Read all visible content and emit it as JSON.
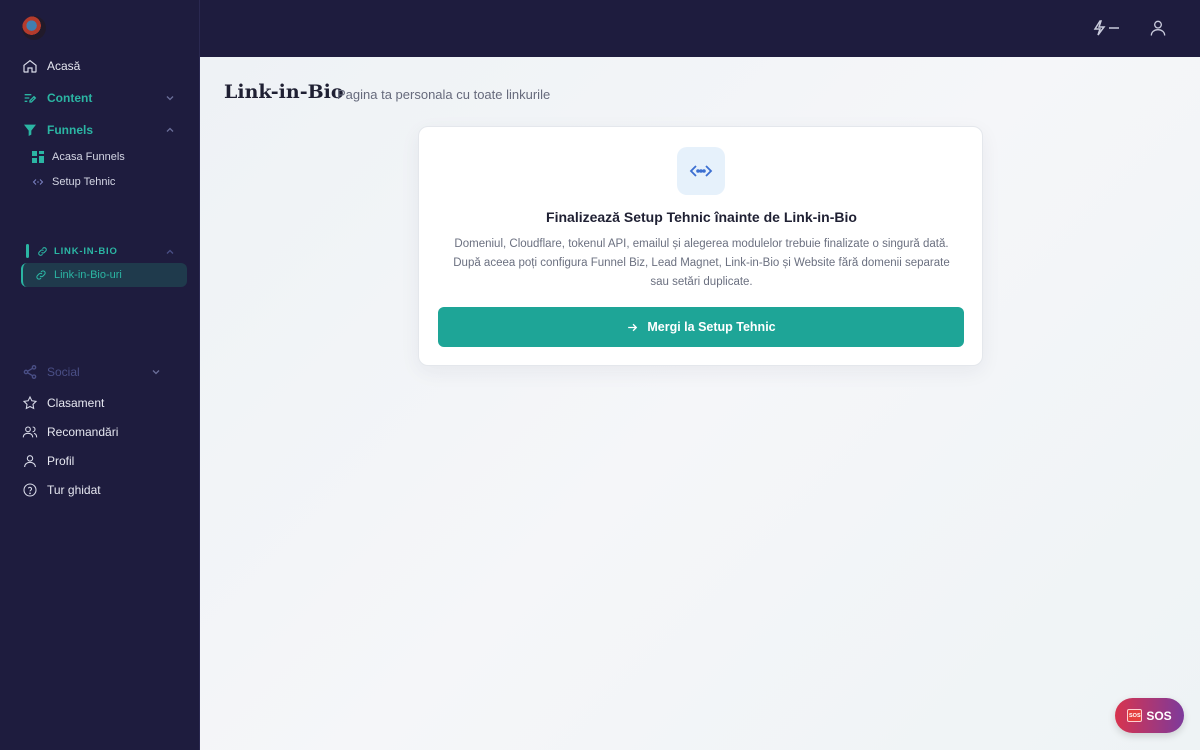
{
  "sidebar": {
    "items": [
      {
        "label": "Acasă",
        "icon": "home-icon"
      },
      {
        "label": "Content",
        "icon": "edit-icon"
      },
      {
        "label": "Funnels",
        "icon": "filter-icon"
      }
    ],
    "funnels_sub": [
      {
        "label": "Acasa Funnels",
        "icon": "dashboard-icon"
      },
      {
        "label": "Setup Tehnic",
        "icon": "code-icon"
      }
    ],
    "section": {
      "label": "LINK-IN-BIO",
      "icon": "link-icon"
    },
    "active_item": {
      "label": "Link-in-Bio-uri",
      "icon": "link-icon"
    },
    "social": {
      "label": "Social",
      "icon": "share-icon"
    },
    "bottom": [
      {
        "label": "Clasament",
        "icon": "star-icon"
      },
      {
        "label": "Recomandări",
        "icon": "users-icon"
      },
      {
        "label": "Profil",
        "icon": "user-icon"
      },
      {
        "label": "Tur ghidat",
        "icon": "help-icon"
      }
    ]
  },
  "topbar": {
    "icons": [
      "bolt-icon",
      "user-icon"
    ]
  },
  "main": {
    "title": "Link-in-Bio",
    "subtitle": "Pagina ta personala cu toate linkurile",
    "card": {
      "title": "Finalizează Setup Tehnic înainte de Link-in-Bio",
      "description": "Domeniul, Cloudflare, tokenul API, emailul și alegerea modulelor trebuie finalizate o singură dată. După aceea poți configura Funnel Biz, Lead Magnet, Link-in-Bio și Website fără domenii separate sau setări duplicate.",
      "button_label": "Mergi la Setup Tehnic"
    }
  },
  "sos": {
    "label": "SOS",
    "badge": "SOS"
  },
  "colors": {
    "sidebar_bg": "#1e1c3e",
    "accent": "#1ea597",
    "accent_text": "#2bb5a3"
  }
}
